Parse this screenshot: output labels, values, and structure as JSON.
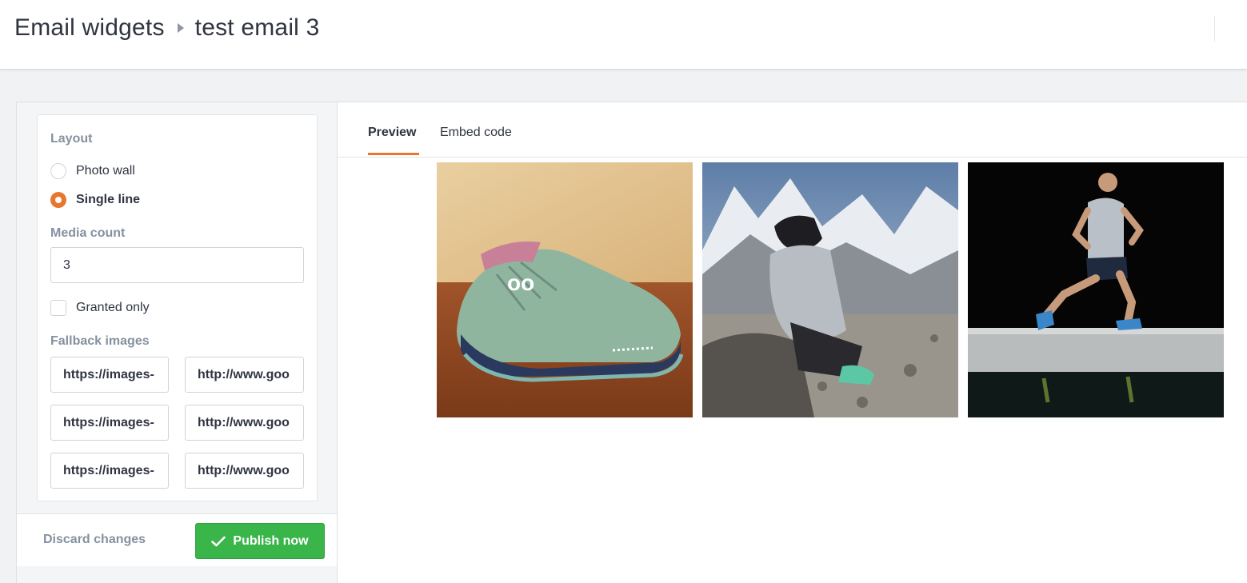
{
  "header": {
    "breadcrumb_root": "Email widgets",
    "breadcrumb_current": "test email 3"
  },
  "settings": {
    "layout_label": "Layout",
    "layout_options": [
      {
        "label": "Photo wall",
        "selected": false
      },
      {
        "label": "Single line",
        "selected": true
      }
    ],
    "media_count_label": "Media count",
    "media_count_value": "3",
    "granted_only_label": "Granted only",
    "granted_only_checked": false,
    "fallback_images_label": "Fallback images",
    "fallback_images": [
      "https://images-",
      "http://www.goo",
      "https://images-",
      "http://www.goo",
      "https://images-",
      "http://www.goo"
    ]
  },
  "footer": {
    "discard_label": "Discard changes",
    "publish_label": "Publish now"
  },
  "preview": {
    "tabs": [
      {
        "label": "Preview",
        "active": true
      },
      {
        "label": "Embed code",
        "active": false
      }
    ],
    "photos": [
      {
        "name": "sneaker-photo"
      },
      {
        "name": "mountain-hiker-photo"
      },
      {
        "name": "runner-photo"
      }
    ]
  },
  "colors": {
    "accent": "#e8772e",
    "publish": "#3ab54a",
    "muted_label": "#8591a1"
  }
}
